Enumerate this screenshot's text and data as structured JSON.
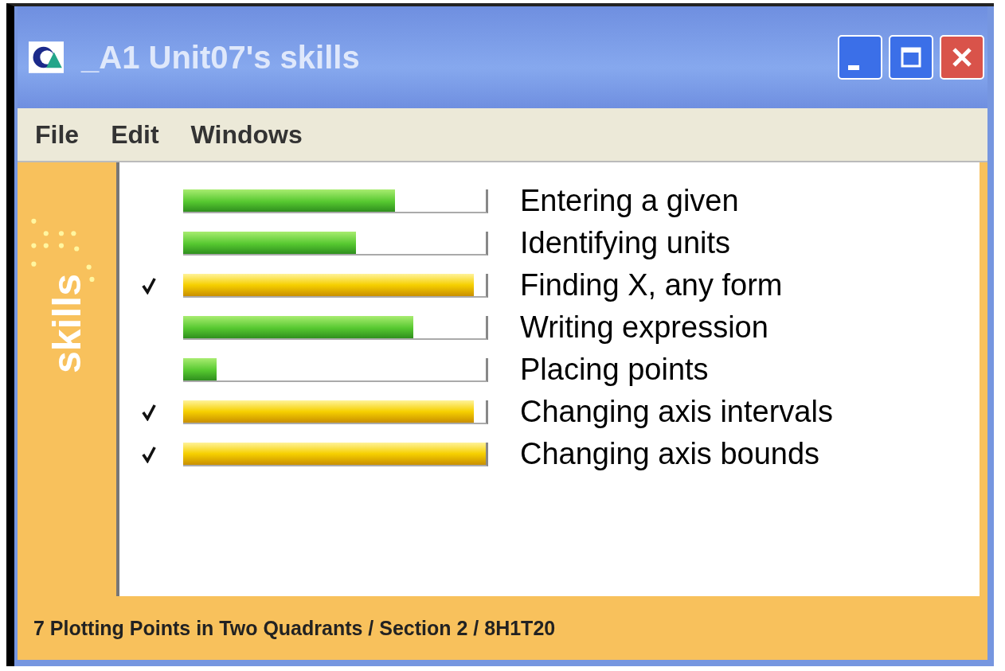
{
  "window": {
    "title": "_A1 Unit07's skills"
  },
  "menu": [
    "File",
    "Edit",
    "Windows"
  ],
  "sidebar": {
    "label": "skills"
  },
  "skills": [
    {
      "label": "Entering a given",
      "level": 0.7,
      "mastered": false
    },
    {
      "label": "Identifying units",
      "level": 0.57,
      "mastered": false
    },
    {
      "label": "Finding X, any form",
      "level": 0.96,
      "mastered": true
    },
    {
      "label": "Writing expression",
      "level": 0.76,
      "mastered": false
    },
    {
      "label": "Placing points",
      "level": 0.11,
      "mastered": false
    },
    {
      "label": "Changing axis intervals",
      "level": 0.96,
      "mastered": true
    },
    {
      "label": "Changing axis bounds",
      "level": 1.0,
      "mastered": true
    }
  ],
  "status_bar": "7  Plotting Points in Two Quadrants / Section 2 / 8H1T20"
}
